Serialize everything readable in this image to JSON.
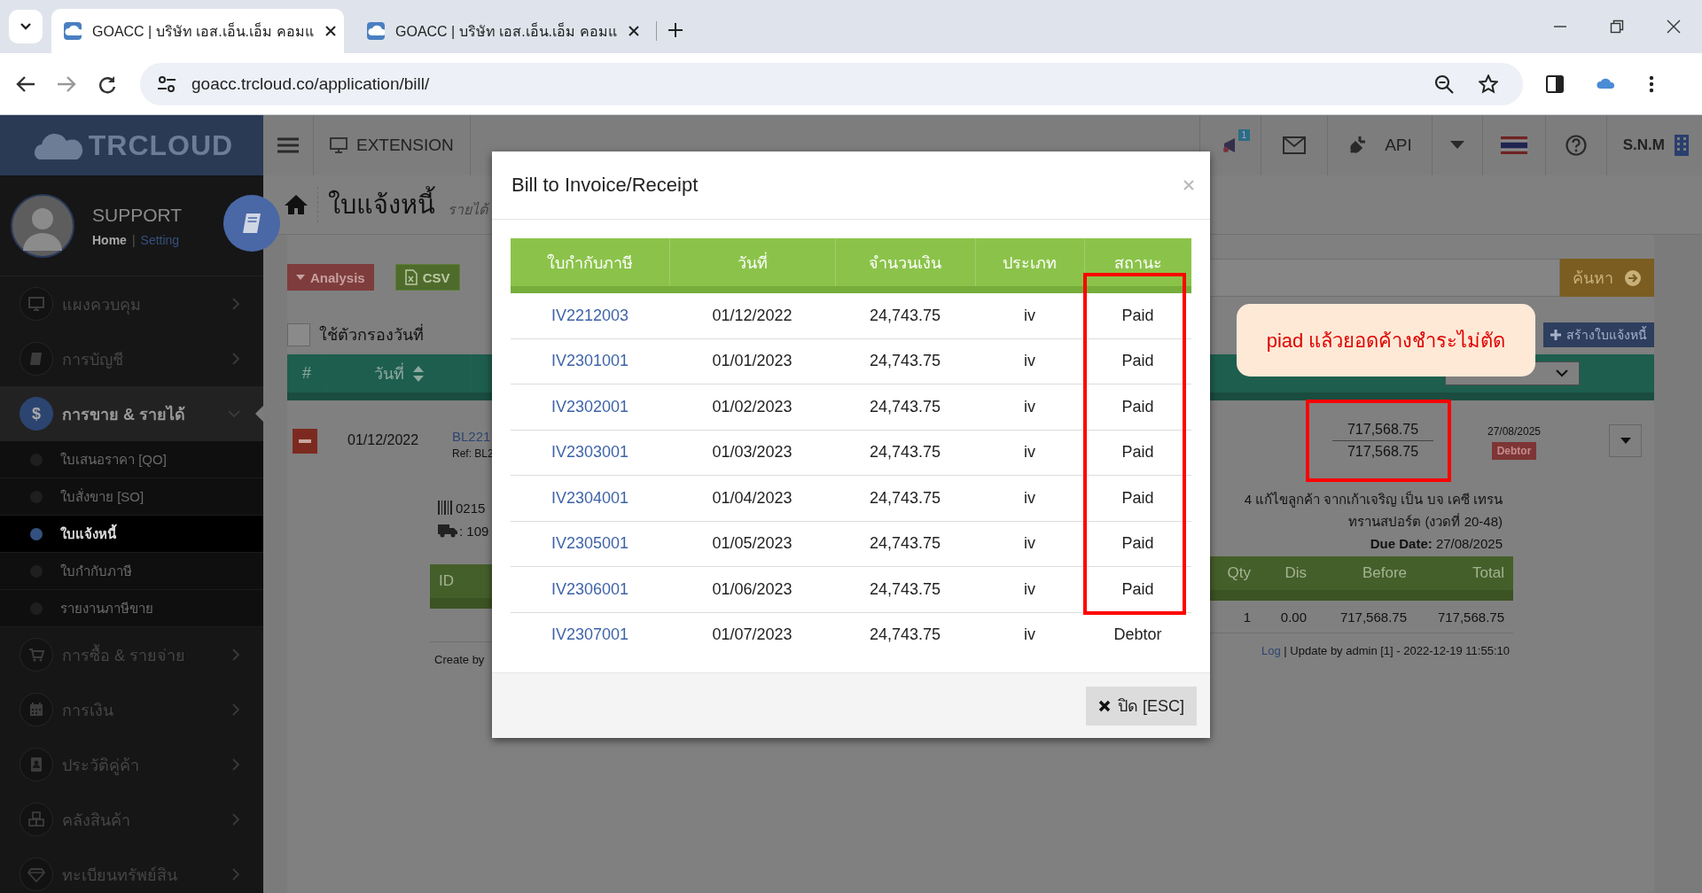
{
  "browser": {
    "tabs": [
      {
        "title": "GOACC | บริษัท เอส.เอ็น.เอ็ม คอมแ",
        "selected": true
      },
      {
        "title": "GOACC | บริษัท เอส.เอ็น.เอ็ม คอมแ",
        "selected": false
      }
    ],
    "url": "goacc.trcloud.co/application/bill/"
  },
  "app_header": {
    "logo": "TRCLOUD",
    "extension": "EXTENSION",
    "notification_badge": "1",
    "api": "API",
    "user": "S.N.M"
  },
  "profile": {
    "name": "SUPPORT",
    "home": "Home",
    "separator": "|",
    "setting": "Setting"
  },
  "sidebar": {
    "items": [
      {
        "label": "แผงควบคุม",
        "expanded": false
      },
      {
        "label": "การบัญชี",
        "expanded": false
      },
      {
        "label": "การขาย & รายได้",
        "icon": "$",
        "expanded": true,
        "children": [
          {
            "label": "ใบเสนอราคา [QO]",
            "selected": false
          },
          {
            "label": "ใบสั่งขาย [SO]",
            "selected": false
          },
          {
            "label": "ใบแจ้งหนี้",
            "selected": true
          },
          {
            "label": "ใบกำกับภาษี",
            "selected": false
          },
          {
            "label": "รายงานภาษีขาย",
            "selected": false
          }
        ]
      },
      {
        "label": "การซื้อ & รายจ่าย",
        "expanded": false
      },
      {
        "label": "การเงิน",
        "expanded": false
      },
      {
        "label": "ประวัติคู่ค้า",
        "expanded": false
      },
      {
        "label": "คลังสินค้า",
        "expanded": false
      },
      {
        "label": "ทะเบียนทรัพย์สิน",
        "expanded": false
      }
    ]
  },
  "page": {
    "title": "ใบแจ้งหนี้",
    "breadcrumb": "รายได้",
    "analysis_button": "Analysis",
    "csv_button": "CSV",
    "search_button": "ค้นหา",
    "create_button": "สร้างใบแจ้งหนี้",
    "date_filter": {
      "label": "ใช้ตัวกรองวันที่",
      "checked": false
    },
    "columns": [
      "#",
      "วันที่"
    ],
    "bill": {
      "date": "01/12/2022",
      "number": "BL221",
      "ref": "Ref: BL2",
      "amount": "717,568.75",
      "balance": "717,568.75",
      "due": "27/08/2025",
      "status": "Debtor",
      "barcode": "0215",
      "delivery": ": 109",
      "note_lines": [
        "4 แก้ไขลูกค้า จากเก้าเจริญ เป็น บจ เคซี เทรน",
        "ทรานสปอร์ต (งวดที่ 20-48)"
      ],
      "due_date": "**Due Date:** 27/08/2025",
      "item_columns": [
        "ID",
        "Qty",
        "Dis",
        "Before",
        "Total"
      ],
      "item_row": [
        "1",
        "0.00",
        "717,568.75",
        "717,568.75"
      ],
      "created": "Create by",
      "log_link": "Log",
      "updated": "| Update by admin [1] - 2022-12-19 11:55:10"
    }
  },
  "annotation": {
    "text": "piad แล้วยอดค้างชำระไม่ตัด"
  },
  "modal": {
    "title": "Bill to Invoice/Receipt",
    "columns": [
      "ใบกำกับภาษี",
      "วันที่",
      "จำนวนเงิน",
      "ประเภท",
      "สถานะ"
    ],
    "rows": [
      {
        "invoice": "IV2212003",
        "date": "01/12/2022",
        "amount": "24,743.75",
        "type": "iv",
        "status": "Paid"
      },
      {
        "invoice": "IV2301001",
        "date": "01/01/2023",
        "amount": "24,743.75",
        "type": "iv",
        "status": "Paid"
      },
      {
        "invoice": "IV2302001",
        "date": "01/02/2023",
        "amount": "24,743.75",
        "type": "iv",
        "status": "Paid"
      },
      {
        "invoice": "IV2303001",
        "date": "01/03/2023",
        "amount": "24,743.75",
        "type": "iv",
        "status": "Paid"
      },
      {
        "invoice": "IV2304001",
        "date": "01/04/2023",
        "amount": "24,743.75",
        "type": "iv",
        "status": "Paid"
      },
      {
        "invoice": "IV2305001",
        "date": "01/05/2023",
        "amount": "24,743.75",
        "type": "iv",
        "status": "Paid"
      },
      {
        "invoice": "IV2306001",
        "date": "01/06/2023",
        "amount": "24,743.75",
        "type": "iv",
        "status": "Paid"
      },
      {
        "invoice": "IV2307001",
        "date": "01/07/2023",
        "amount": "24,743.75",
        "type": "iv",
        "status": "Debtor"
      }
    ],
    "close_button": "ปิด [ESC]"
  }
}
